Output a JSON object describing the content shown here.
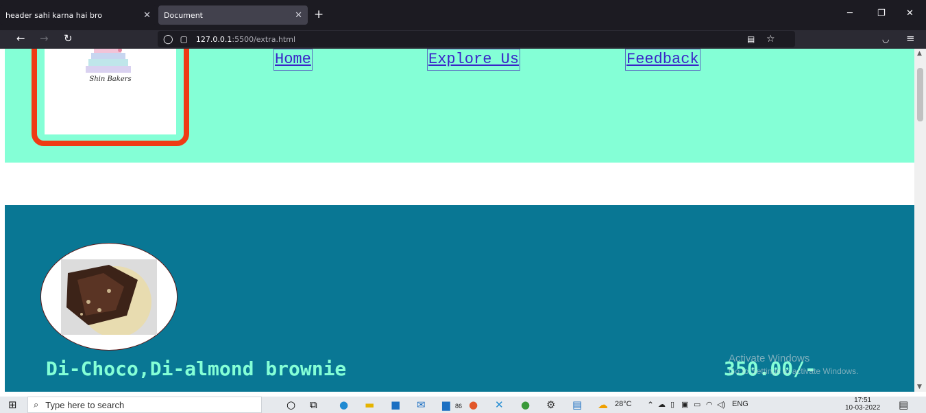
{
  "browser": {
    "tabs": [
      {
        "title": "header sahi karna hai bro",
        "active": false
      },
      {
        "title": "Document",
        "active": true
      }
    ],
    "url": {
      "host": "127.0.0.1",
      "path": ":5500/extra.html"
    }
  },
  "page": {
    "logo_text": "Shin Bakers",
    "nav_links": {
      "home": "Home",
      "explore": "Explore Us",
      "feedback": "Feedback"
    },
    "product": {
      "name": "Di-Choco,Di-almond brownie",
      "price": "350.00/-"
    },
    "watermark": {
      "line1": "Activate Windows",
      "line2": "Go to Settings to activate Windows."
    }
  },
  "taskbar": {
    "search_placeholder": "Type here to search",
    "badge_count": "86",
    "temperature": "28°C",
    "language": "ENG",
    "time": "17:51",
    "date": "10-03-2022"
  },
  "colors": {
    "header_bg": "#84ffd6",
    "logo_border": "#ef3b14",
    "product_section_bg": "#097794",
    "product_text": "#84ffd6",
    "link": "#3a24c8"
  }
}
